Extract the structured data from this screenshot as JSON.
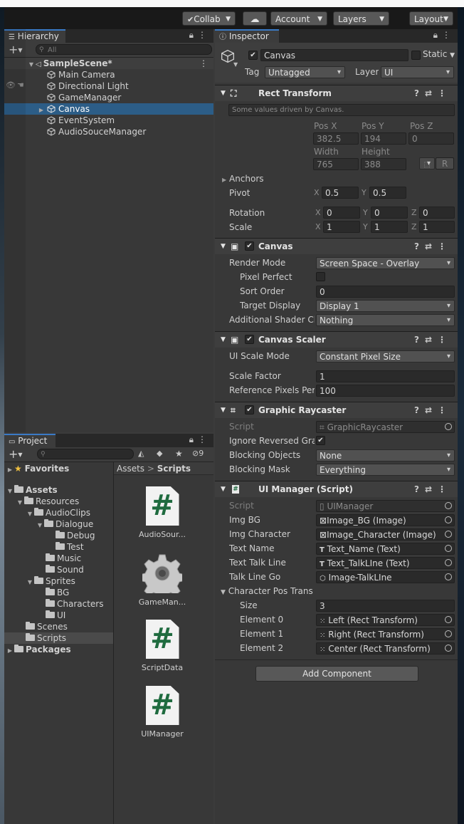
{
  "toolbar": {
    "collab": "Collab",
    "account": "Account",
    "layers": "Layers",
    "layout": "Layout"
  },
  "hierarchy": {
    "tab": "Hierarchy",
    "search_placeholder": "All",
    "scene": "SampleScene*",
    "items": [
      "Main Camera",
      "Directional Light",
      "GameManager",
      "Canvas",
      "EventSystem",
      "AudioSouceManager"
    ],
    "selected": "Canvas"
  },
  "project": {
    "tab": "Project",
    "hidden_count": "9",
    "favorites": "Favorites",
    "assets": "Assets",
    "tree": [
      "Resources",
      "AudioClips",
      "Dialogue",
      "Debug",
      "Test",
      "Music",
      "Sound",
      "Sprites",
      "BG",
      "Characters",
      "UI",
      "Scenes",
      "Scripts"
    ],
    "packages": "Packages",
    "breadcrumb_root": "Assets",
    "breadcrumb_sep": ">",
    "breadcrumb_current": "Scripts",
    "files": [
      "AudioSour...",
      "GameMan...",
      "ScriptData",
      "UIManager"
    ]
  },
  "inspector": {
    "tab": "Inspector",
    "object_name": "Canvas",
    "static_label": "Static",
    "tag_label": "Tag",
    "tag_value": "Untagged",
    "layer_label": "Layer",
    "layer_value": "UI",
    "rect_transform": {
      "title": "Rect Transform",
      "note": "Some values driven by Canvas.",
      "pos_x_label": "Pos X",
      "pos_y_label": "Pos Y",
      "pos_z_label": "Pos Z",
      "pos_x": "382.5",
      "pos_y": "194",
      "pos_z": "0",
      "width_label": "Width",
      "height_label": "Height",
      "width": "765",
      "height": "388",
      "r_button": "R",
      "anchors": "Anchors",
      "pivot": "Pivot",
      "pivot_x": "0.5",
      "pivot_y": "0.5",
      "rotation": "Rotation",
      "rot_x": "0",
      "rot_y": "0",
      "rot_z": "0",
      "scale": "Scale",
      "scale_x": "1",
      "scale_y": "1",
      "scale_z": "1",
      "x": "X",
      "y": "Y",
      "z": "Z"
    },
    "canvas": {
      "title": "Canvas",
      "render_mode_label": "Render Mode",
      "render_mode": "Screen Space - Overlay",
      "pixel_perfect_label": "Pixel Perfect",
      "sort_order_label": "Sort Order",
      "sort_order": "0",
      "target_display_label": "Target Display",
      "target_display": "Display 1",
      "shader_label": "Additional Shader Ch",
      "shader": "Nothing"
    },
    "canvas_scaler": {
      "title": "Canvas Scaler",
      "ui_scale_mode_label": "UI Scale Mode",
      "ui_scale_mode": "Constant Pixel Size",
      "scale_factor_label": "Scale Factor",
      "scale_factor": "1",
      "ref_ppu_label": "Reference Pixels Per",
      "ref_ppu": "100"
    },
    "graphic_raycaster": {
      "title": "Graphic Raycaster",
      "script_label": "Script",
      "script": "GraphicRaycaster",
      "ignore_label": "Ignore Reversed Grap",
      "blocking_objects_label": "Blocking Objects",
      "blocking_objects": "None",
      "blocking_mask_label": "Blocking Mask",
      "blocking_mask": "Everything"
    },
    "ui_manager": {
      "title": "UI Manager (Script)",
      "script_label": "Script",
      "script": "UIManager",
      "img_bg_label": "Img BG",
      "img_bg": "Image_BG (Image)",
      "img_char_label": "Img Character",
      "img_char": "Image_Character (Image)",
      "text_name_label": "Text Name",
      "text_name": "Text_Name (Text)",
      "text_talk_label": "Text Talk Line",
      "text_talk": "Text_TalkLIne (Text)",
      "talk_go_label": "Talk Line Go",
      "talk_go": "Image-TalkLIne",
      "char_pos_label": "Character Pos Trans",
      "size_label": "Size",
      "size": "3",
      "elements": [
        {
          "label": "Element 0",
          "value": "Left (Rect Transform)"
        },
        {
          "label": "Element 1",
          "value": "Right (Rect Transform)"
        },
        {
          "label": "Element 2",
          "value": "Center (Rect Transform)"
        }
      ]
    },
    "add_component": "Add Component"
  },
  "colors": {
    "selection": "#2c5d87",
    "tab_accent": "#3a7ac6",
    "script_hash": "#1f6b3f"
  }
}
